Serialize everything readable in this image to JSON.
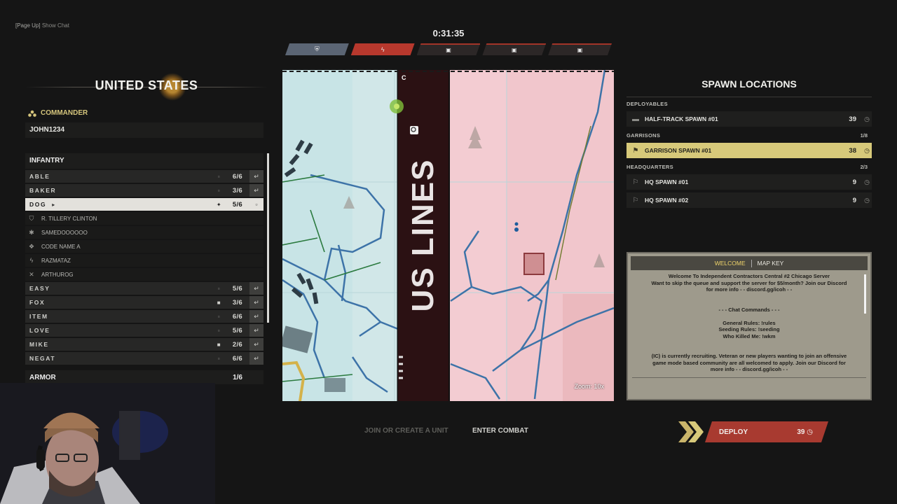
{
  "hint": {
    "key": "[Page Up]",
    "text": "Show Chat"
  },
  "timer": "0:31:35",
  "phases": [
    {
      "icon": "shield-icon",
      "glyph": "⛨"
    },
    {
      "icon": "lightning-icon",
      "glyph": "ϟ"
    },
    {
      "icon": "lock-icon",
      "glyph": "🔒"
    },
    {
      "icon": "lock-icon",
      "glyph": "🔒"
    },
    {
      "icon": "lock-icon",
      "glyph": "🔒"
    }
  ],
  "faction": {
    "title": "UNITED STATES"
  },
  "commander": {
    "label": "COMMANDER",
    "name": "JOHN1234"
  },
  "infantry": {
    "header": "INFANTRY",
    "squads_top": [
      {
        "name": "ABLE",
        "count": "6/6",
        "locked": false
      },
      {
        "name": "BAKER",
        "count": "3/6",
        "locked": false
      },
      {
        "name": "DOG",
        "count": "5/6",
        "locked": false,
        "selected": true
      }
    ],
    "members": [
      {
        "name": "R. TILLERY CLINTON",
        "icon": "officer-icon",
        "glyph": "⛉"
      },
      {
        "name": "SAMEDOOOOOO",
        "icon": "rifleman-icon",
        "glyph": "✱"
      },
      {
        "name": "CODE NAME A",
        "icon": "support-icon",
        "glyph": "❖"
      },
      {
        "name": "RAZMATAZ",
        "icon": "assault-icon",
        "glyph": "ϟ"
      },
      {
        "name": "ARTHUROG",
        "icon": "crossed-rifles-icon",
        "glyph": "✕"
      }
    ],
    "squads_bottom": [
      {
        "name": "EASY",
        "count": "5/6",
        "locked": false
      },
      {
        "name": "FOX",
        "count": "3/6",
        "locked": true
      },
      {
        "name": "ITEM",
        "count": "6/6",
        "locked": false
      },
      {
        "name": "LOVE",
        "count": "5/6",
        "locked": false
      },
      {
        "name": "MIKE",
        "count": "2/6",
        "locked": true
      },
      {
        "name": "NEGAT",
        "count": "6/6",
        "locked": false
      }
    ]
  },
  "armor": {
    "label": "ARMOR",
    "count": "1/6"
  },
  "map": {
    "banner": "US LINES",
    "grid_letter": "C",
    "zoom": "Zoom: 10x"
  },
  "spawn": {
    "title": "SPAWN LOCATIONS",
    "deployables": {
      "label": "DEPLOYABLES",
      "items": [
        {
          "name": "HALF-TRACK SPAWN #01",
          "count": "39",
          "icon": "halftrack-icon"
        }
      ]
    },
    "garrisons": {
      "label": "GARRISONS",
      "count": "1/8",
      "items": [
        {
          "name": "GARRISON SPAWN #01",
          "count": "38",
          "icon": "garrison-icon",
          "selected": true
        }
      ]
    },
    "headquarters": {
      "label": "HEADQUARTERS",
      "count": "2/3",
      "items": [
        {
          "name": "HQ SPAWN #01",
          "count": "9",
          "icon": "flag-icon"
        },
        {
          "name": "HQ SPAWN #02",
          "count": "9",
          "icon": "flag-icon"
        }
      ]
    }
  },
  "info": {
    "tab_welcome": "WELCOME",
    "tab_mapkey": "MAP KEY",
    "lines": [
      "Welcome To Independent Contractors Central #2 Chicago Server",
      "Want to skip the queue and support the server for $5/month? Join our Discord",
      "for more info - - discord.gg/icoh - -",
      "",
      "",
      "- - - Chat Commands - - -",
      "",
      "General Rules: !rules",
      "Seeding Rules: !seeding",
      "Who Killed Me: !wkm",
      "",
      "",
      "(IC) is currently recruiting. Veteran or new players wanting to join an offensive",
      "game mode based community are all welcomed to apply. Join our Discord for",
      "more info - - discord.gg/icoh - -"
    ]
  },
  "actions": {
    "join_unit": "JOIN OR CREATE A UNIT",
    "enter_combat": "ENTER COMBAT",
    "deploy": "DEPLOY",
    "deploy_timer": "39"
  },
  "colors": {
    "accent_red": "#a83a30",
    "selected_gold": "#d7c97a",
    "us_blue": "#c9e3e5",
    "enemy_pink": "#f2cdd2"
  }
}
